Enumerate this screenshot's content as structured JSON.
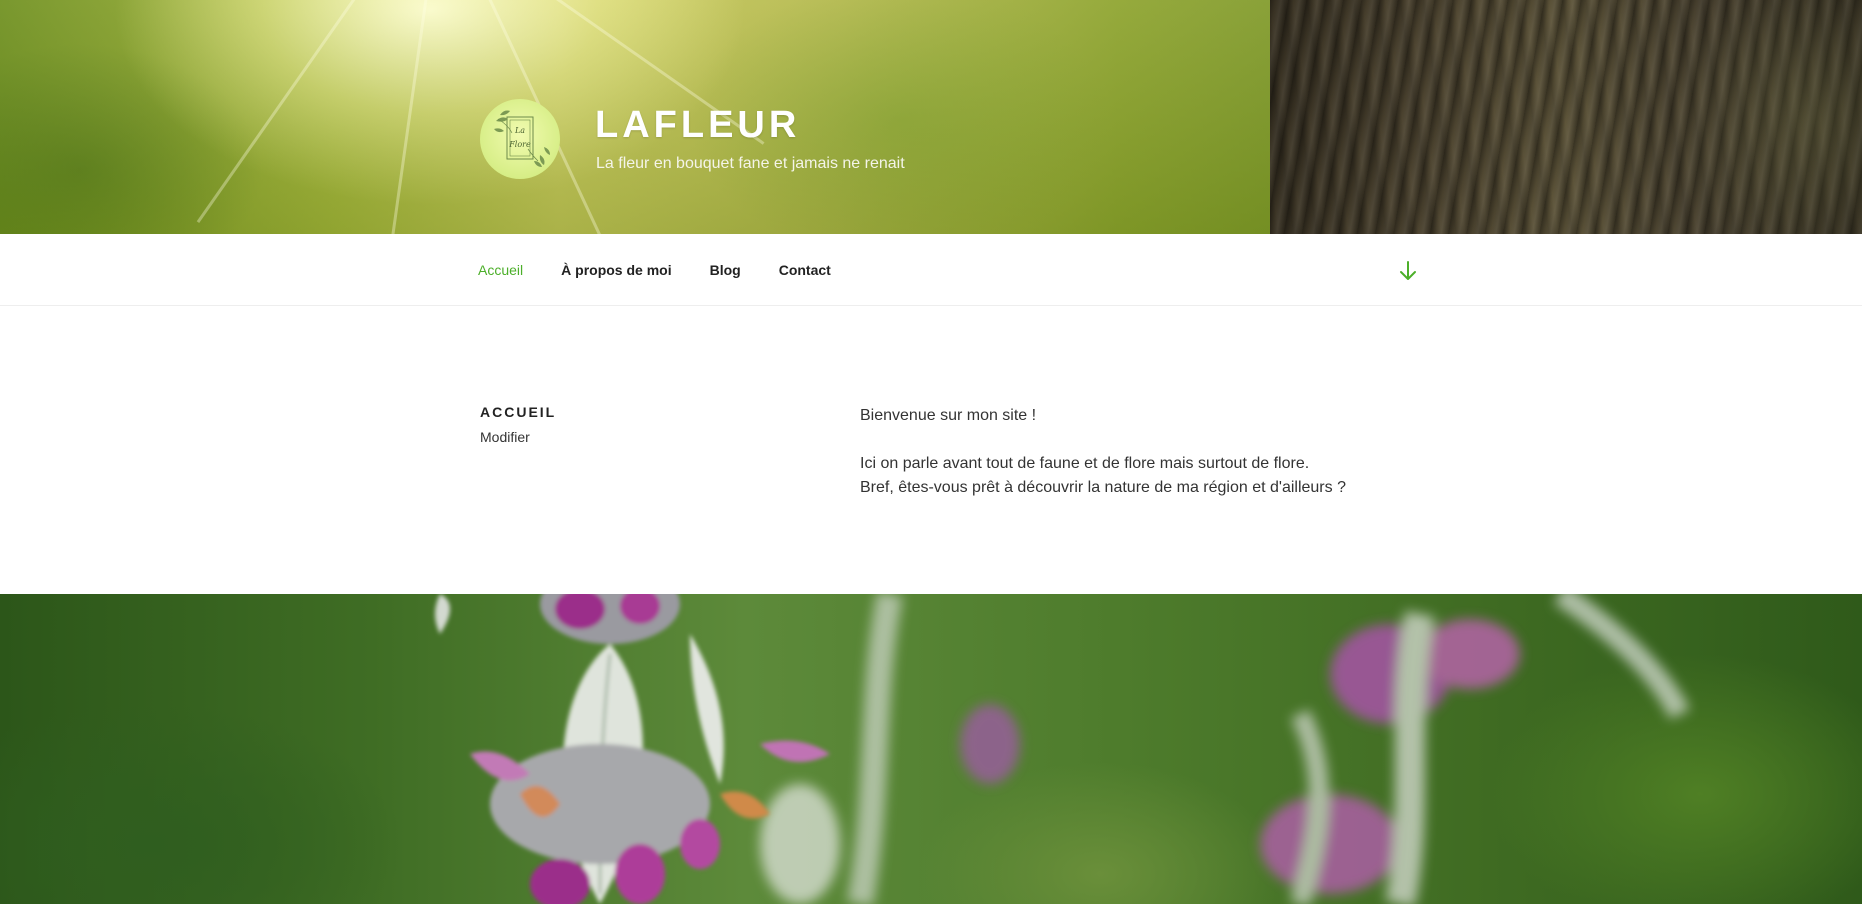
{
  "site": {
    "title": "LAFLEUR",
    "tagline": "La fleur en bouquet fane et jamais ne renait",
    "logo_text_top": "La",
    "logo_text_bottom": "Flore"
  },
  "nav": {
    "items": [
      {
        "label": "Accueil",
        "active": true
      },
      {
        "label": "À propos de moi",
        "active": false
      },
      {
        "label": "Blog",
        "active": false
      },
      {
        "label": "Contact",
        "active": false
      }
    ],
    "scroll_icon": "arrow-down-icon"
  },
  "page": {
    "title": "ACCUEIL",
    "edit_label": "Modifier",
    "paragraphs": [
      "Bienvenue sur mon site !",
      "Ici on parle avant tout de faune et de flore mais surtout de flore.",
      "Bref, êtes-vous prêt à découvrir la nature de ma région et d'ailleurs ?"
    ]
  },
  "colors": {
    "accent": "#4caf2a",
    "text": "#333333",
    "logo_bg": "#d7ee87"
  }
}
